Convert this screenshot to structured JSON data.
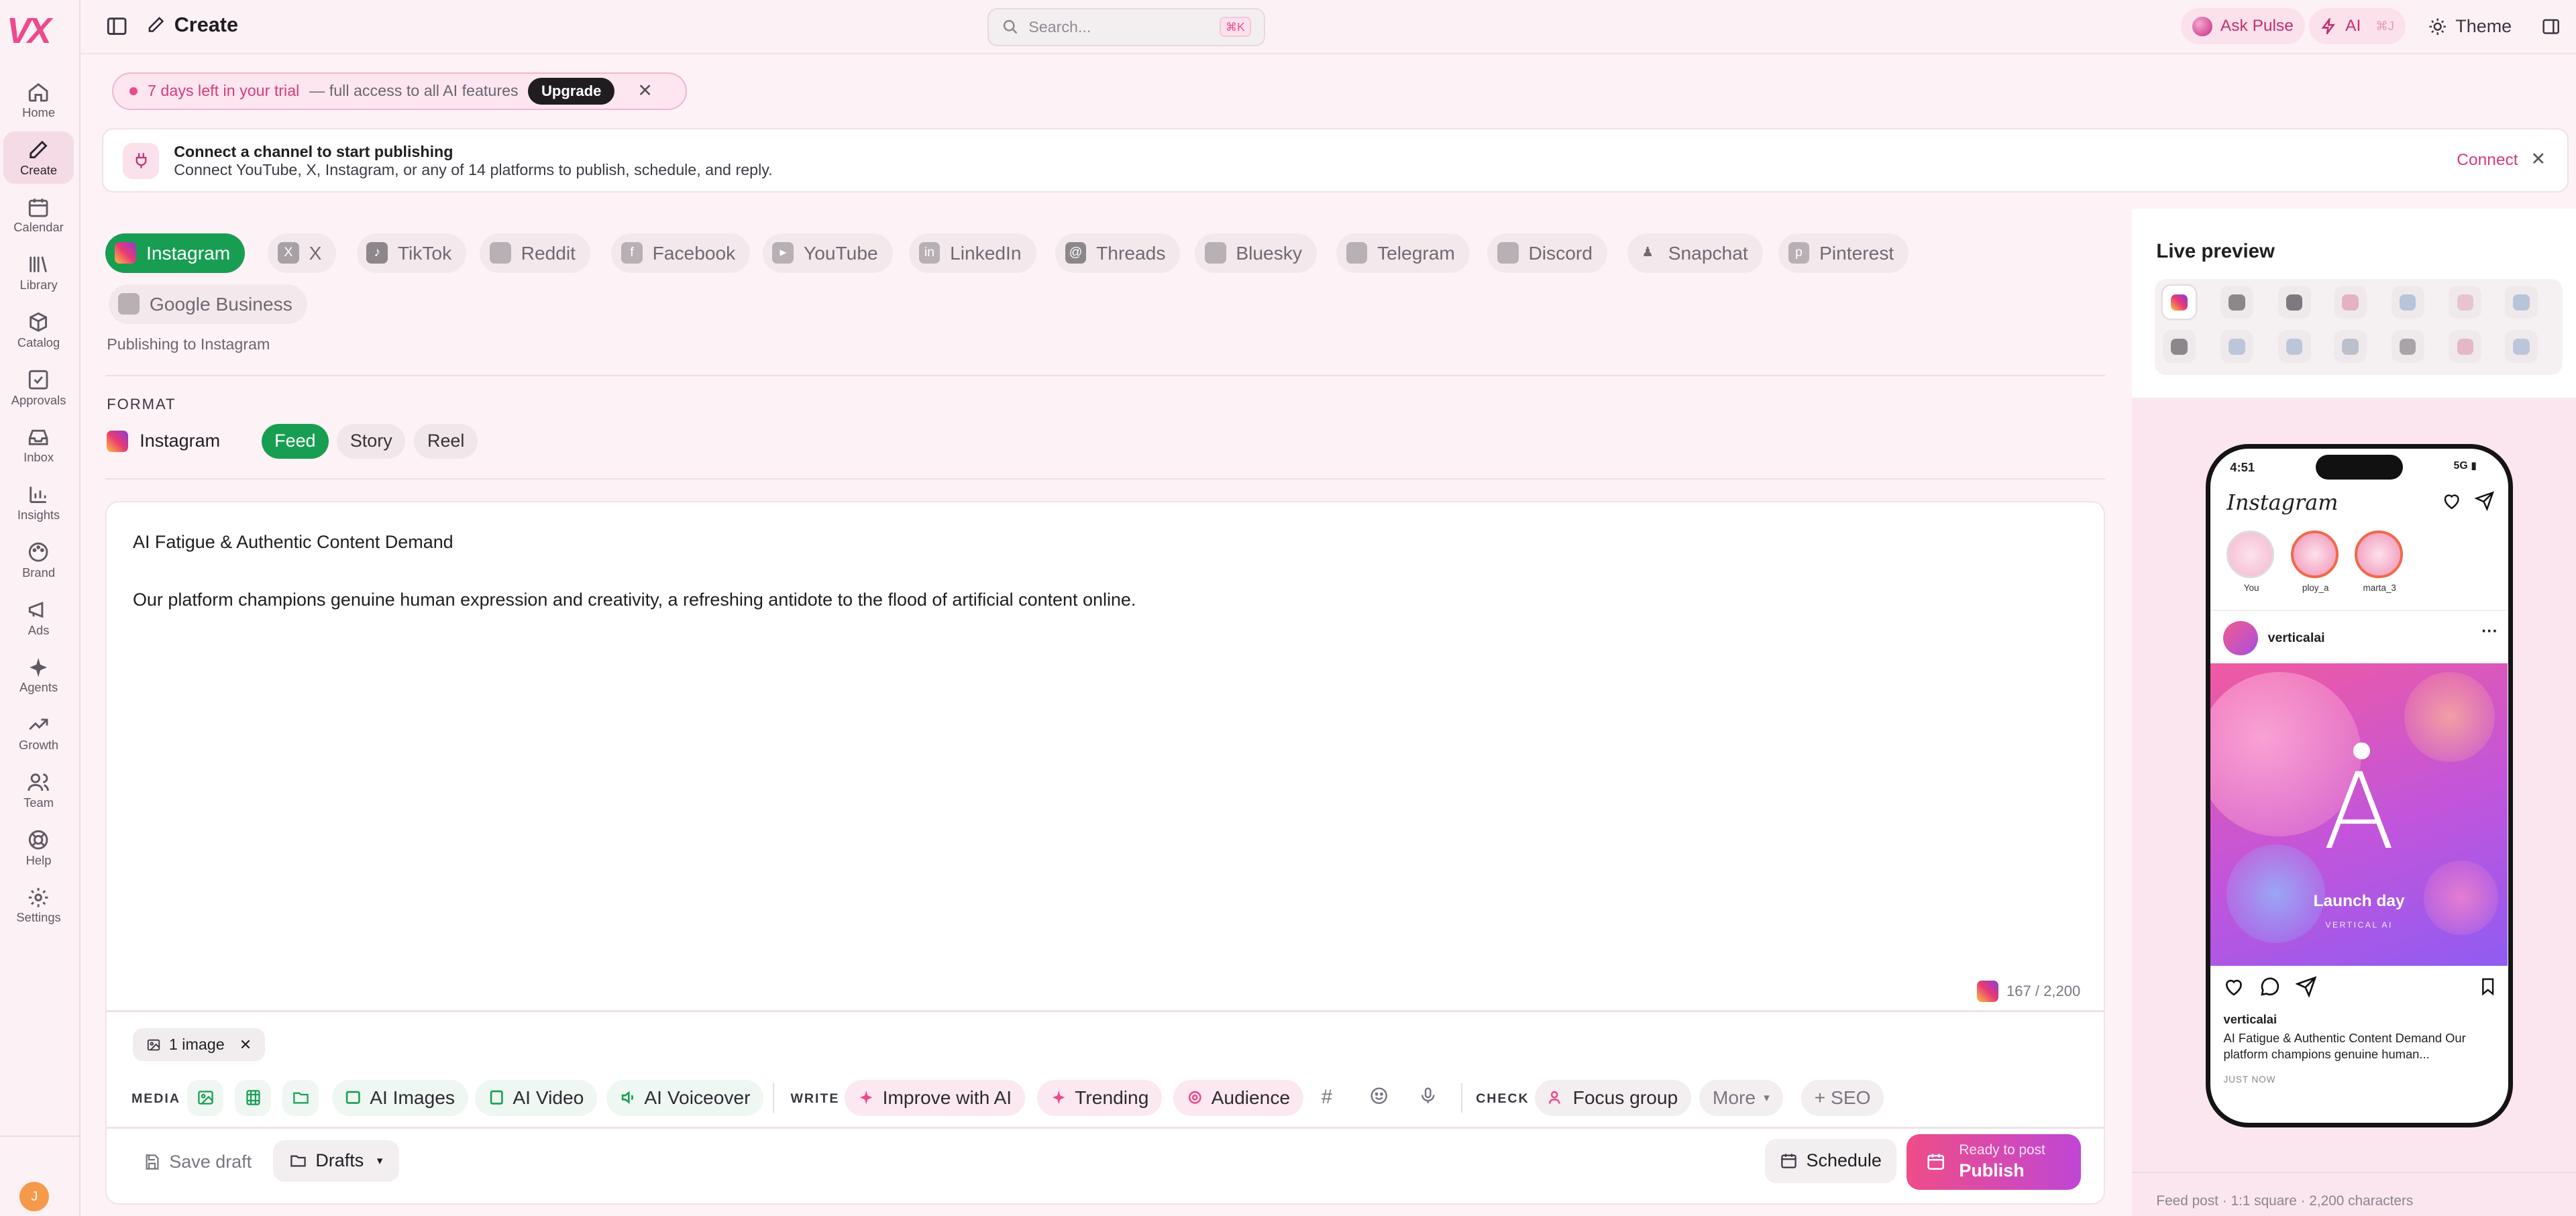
{
  "brand": {
    "accent": "#ec4a8c",
    "green": "#189e52",
    "logo_text": "VX"
  },
  "nav": [
    {
      "label": "Home",
      "icon": "home-icon"
    },
    {
      "label": "Create",
      "icon": "pencil-icon",
      "active": true
    },
    {
      "label": "Calendar",
      "icon": "calendar-icon"
    },
    {
      "label": "Library",
      "icon": "library-icon"
    },
    {
      "label": "Catalog",
      "icon": "box-icon"
    },
    {
      "label": "Approvals",
      "icon": "check-square-icon"
    },
    {
      "label": "Inbox",
      "icon": "inbox-icon"
    },
    {
      "label": "Insights",
      "icon": "chart-icon"
    },
    {
      "label": "Brand",
      "icon": "palette-icon"
    },
    {
      "label": "Ads",
      "icon": "megaphone-icon"
    },
    {
      "label": "Agents",
      "icon": "sparkle-icon"
    },
    {
      "label": "Growth",
      "icon": "trend-icon"
    },
    {
      "label": "Team",
      "icon": "users-icon"
    },
    {
      "label": "Help",
      "icon": "lifebuoy-icon"
    },
    {
      "label": "Settings",
      "icon": "gear-icon"
    }
  ],
  "user": {
    "initial": "J"
  },
  "header": {
    "title": "Create",
    "search_placeholder": "Search...",
    "search_shortcut": "⌘K",
    "ask_pulse": "Ask Pulse",
    "ai_label": "AI",
    "ai_shortcut": "⌘J",
    "theme_label": "Theme"
  },
  "trial": {
    "highlight": "7 days left in your trial",
    "rest": "— full access to all AI features",
    "button": "Upgrade"
  },
  "connect_banner": {
    "title": "Connect a channel to start publishing",
    "subtitle": "Connect YouTube, X, Instagram, or any of 14 platforms to publish, schedule, and reply.",
    "action": "Connect"
  },
  "platforms": [
    {
      "label": "Instagram",
      "active": true
    },
    {
      "label": "X"
    },
    {
      "label": "TikTok"
    },
    {
      "label": "Reddit"
    },
    {
      "label": "Facebook"
    },
    {
      "label": "YouTube"
    },
    {
      "label": "LinkedIn"
    },
    {
      "label": "Threads"
    },
    {
      "label": "Bluesky"
    },
    {
      "label": "Telegram"
    },
    {
      "label": "Discord"
    },
    {
      "label": "Snapchat"
    },
    {
      "label": "Pinterest"
    },
    {
      "label": "Google Business"
    }
  ],
  "publishing_to": "Publishing to Instagram",
  "format": {
    "heading": "FORMAT",
    "platform": "Instagram",
    "options": [
      {
        "label": "Feed",
        "selected": true
      },
      {
        "label": "Story"
      },
      {
        "label": "Reel"
      }
    ]
  },
  "post": {
    "title": "AI Fatigue & Authentic Content Demand",
    "body": "Our platform champions genuine human expression and creativity, a refreshing antidote to the flood of artificial content online.",
    "char_count": "167 / 2,200"
  },
  "attachment": {
    "label": "1 image"
  },
  "toolbar": {
    "media_label": "MEDIA",
    "ai_images": "AI Images",
    "ai_video": "AI Video",
    "ai_voiceover": "AI Voiceover",
    "write_label": "WRITE",
    "improve": "Improve with AI",
    "trending": "Trending",
    "audience": "Audience",
    "check_label": "CHECK",
    "focus_group": "Focus group",
    "more": "More",
    "seo": "+ SEO"
  },
  "footer_actions": {
    "save_draft": "Save draft",
    "drafts": "Drafts",
    "schedule": "Schedule",
    "publish_small": "Ready to post",
    "publish": "Publish"
  },
  "preview": {
    "title": "Live preview",
    "phone_time": "4:51",
    "phone_signal": "5G",
    "app_name": "Instagram",
    "stories": [
      "You",
      "ploy_a",
      "marta_3"
    ],
    "account": "verticalai",
    "image_letter": "A",
    "image_title": "Launch day",
    "image_subtitle": "VERTICAL AI",
    "caption_user": "verticalai",
    "caption": "AI Fatigue & Authentic Content Demand Our platform champions genuine human...",
    "time": "JUST NOW",
    "footer": "Feed post · 1:1 square · 2,200 characters"
  }
}
